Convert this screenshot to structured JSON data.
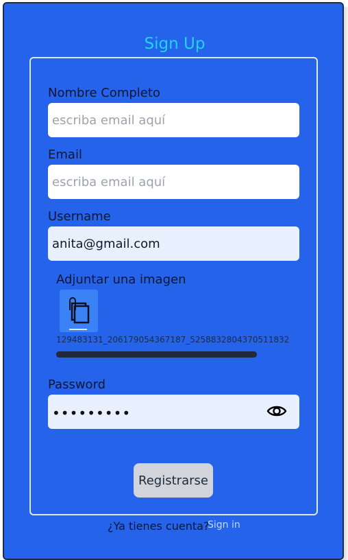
{
  "form": {
    "title": "Sign Up",
    "full_name": {
      "label": "Nombre Completo",
      "placeholder": "escriba email aquí",
      "value": ""
    },
    "email": {
      "label": "Email",
      "placeholder": "escriba email aquí",
      "value": ""
    },
    "username": {
      "label": "Username",
      "value": "anita@gmail.com"
    },
    "attachment": {
      "label": "Adjuntar una imagen",
      "icon": "file-attachment-icon",
      "file_name": "129483131_206179054367187_5258832804370511832",
      "progress": 1.0
    },
    "password": {
      "label": "Password",
      "masked_value": "•••••••••",
      "toggle_icon": "eye-icon"
    },
    "submit_label": "Registrarse"
  },
  "footer": {
    "question": "¿Ya tienes cuenta?",
    "link_label": "Sign in"
  },
  "colors": {
    "card_bg": "#2563eb",
    "title": "#22d3ee",
    "field_filled": "#e8f0fe",
    "button_bg": "#d1d5db"
  }
}
